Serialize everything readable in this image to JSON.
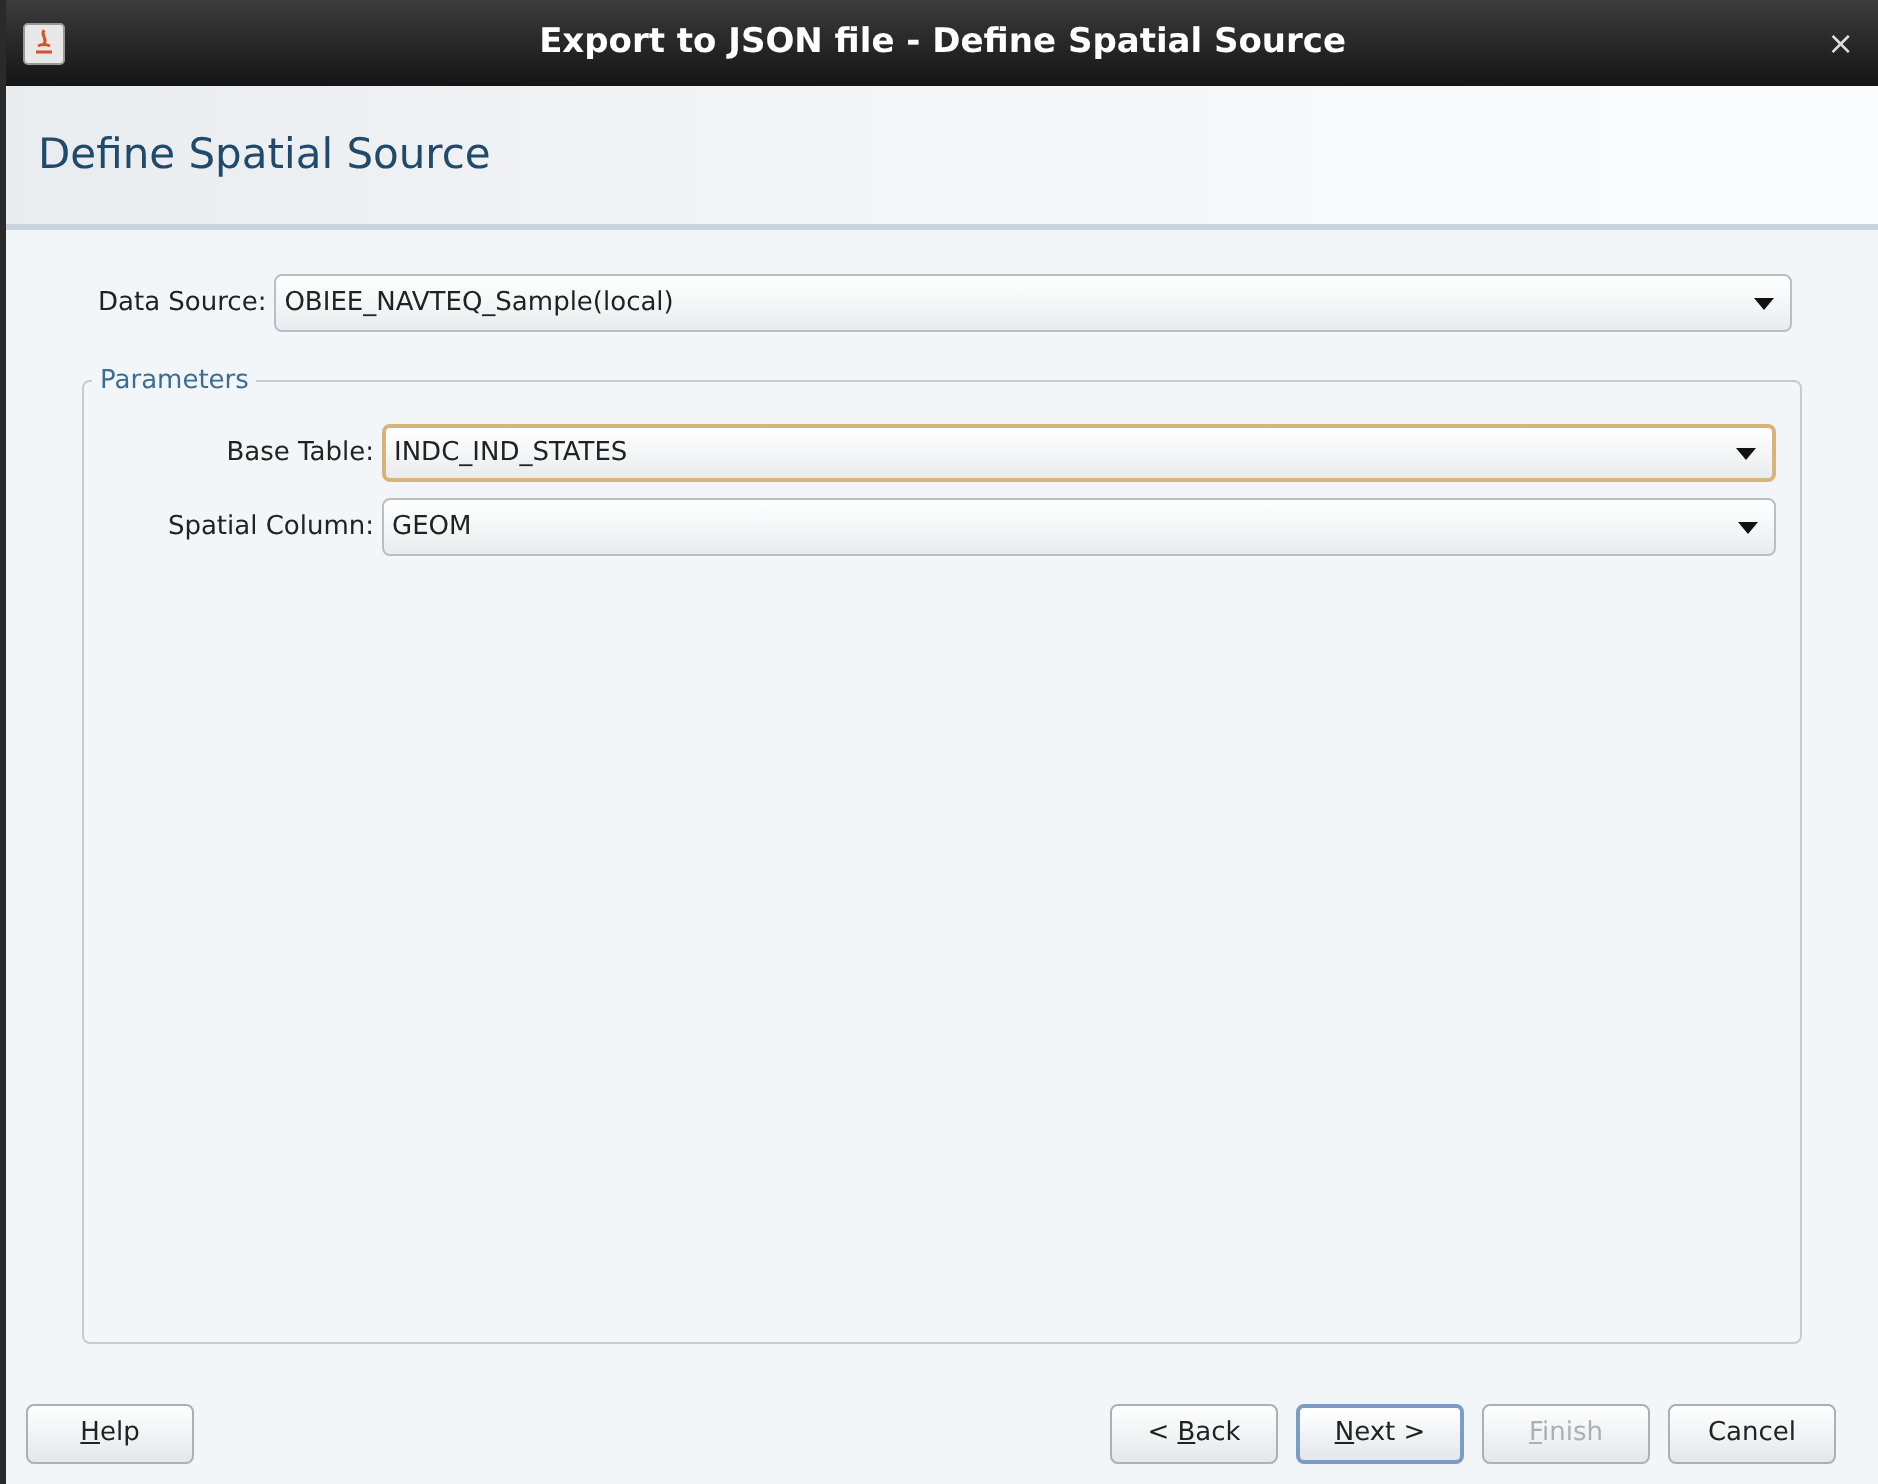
{
  "window": {
    "title": "Export to JSON file - Define Spatial Source",
    "close": "×"
  },
  "header": {
    "title": "Define Spatial Source"
  },
  "data_source": {
    "label": "Data Source:",
    "value": "OBIEE_NAVTEQ_Sample(local)",
    "focused": false
  },
  "parameters": {
    "title": "Parameters",
    "fields": [
      {
        "label": "Base Table:",
        "value": "INDC_IND_STATES",
        "focused": true
      },
      {
        "label": "Spatial Column:",
        "value": "GEOM",
        "focused": false
      }
    ]
  },
  "buttons": [
    {
      "mnemonic": "H",
      "after": "elp",
      "default": false,
      "disabled": false
    },
    {
      "before": "< ",
      "mnemonic": "B",
      "after": "ack",
      "default": false,
      "disabled": false
    },
    {
      "mnemonic": "N",
      "after": "ext >",
      "default": true,
      "disabled": false
    },
    {
      "mnemonic": "F",
      "after": "inish",
      "default": false,
      "disabled": true
    },
    {
      "after": "Cancel",
      "default": false,
      "disabled": false
    }
  ]
}
